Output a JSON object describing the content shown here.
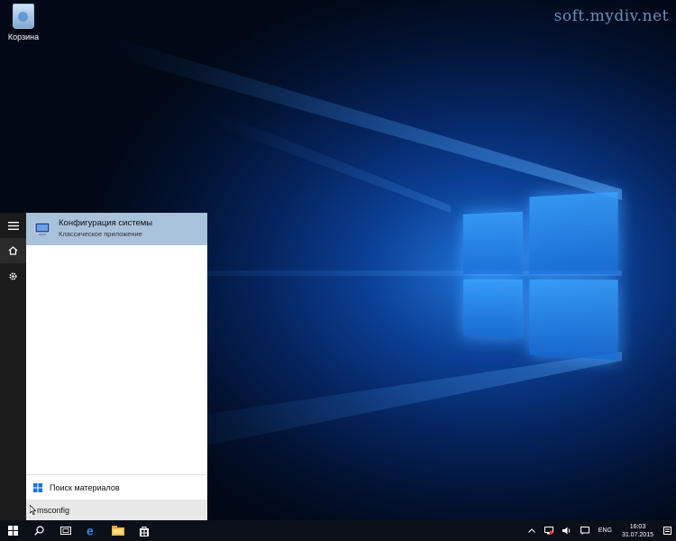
{
  "watermark": "soft.mydiv.net",
  "desktop": {
    "recycle_bin_label": "Корзина"
  },
  "start_menu": {
    "rail": [
      "hamburger-icon",
      "home-icon",
      "gear-icon"
    ],
    "top_result": {
      "title": "Конфигурация системы",
      "subtitle": "Классическое приложение"
    },
    "search_materials_label": "Поиск материалов",
    "search_query": "msconfig"
  },
  "taskbar": {
    "icons": [
      "windows-start-icon",
      "search-icon",
      "task-view-icon",
      "edge-icon",
      "file-explorer-icon",
      "store-icon"
    ],
    "tray": {
      "language": "ENG",
      "time": "16:03",
      "date": "31.07.2015"
    }
  },
  "colors": {
    "result_highlight": "#a9c2dc",
    "taskbar": "#0b0f18",
    "accent": "#1f74d6"
  }
}
